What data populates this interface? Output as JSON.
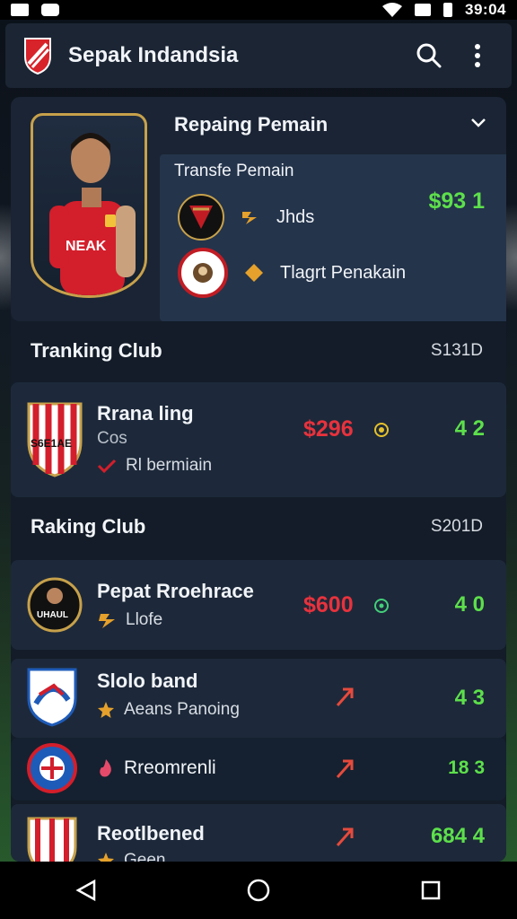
{
  "status": {
    "time": "39:04"
  },
  "header": {
    "title": "Sepak Indandsia"
  },
  "hero": {
    "title": "Repaing Pemain",
    "jersey_text": "NEAK",
    "transfer_title": "Transfe Pemain",
    "transfer_value": "$93 1",
    "rows": [
      {
        "label": "Jhds"
      },
      {
        "label": "Tlagrt Penakain"
      }
    ]
  },
  "section1": {
    "title": "Tranking Club",
    "code": "S131D",
    "clubs": [
      {
        "name": "Rrana ling",
        "sub": "Cos",
        "extra": "Rl bermiain",
        "price": "$296",
        "score": "4 2",
        "logo_text": "S6E1AE"
      }
    ]
  },
  "section2": {
    "title": "Raking Club",
    "code": "S201D",
    "clubs": [
      {
        "name": "Pepat Rroehrace",
        "sub": "Llofe",
        "price": "$600",
        "score": "4 0",
        "logo_text": "UHAUL"
      },
      {
        "name": "Slolo band",
        "sub": "Aeans Panoing",
        "score": "4 3"
      },
      {
        "name": "Rreomrenli",
        "score": "18 3"
      },
      {
        "name": "Reotlbened",
        "sub": "Geen",
        "score": "684 4"
      }
    ]
  },
  "colors": {
    "accent_green": "#5de04b",
    "price_red": "#e8323d",
    "gold": "#c7a14b"
  }
}
